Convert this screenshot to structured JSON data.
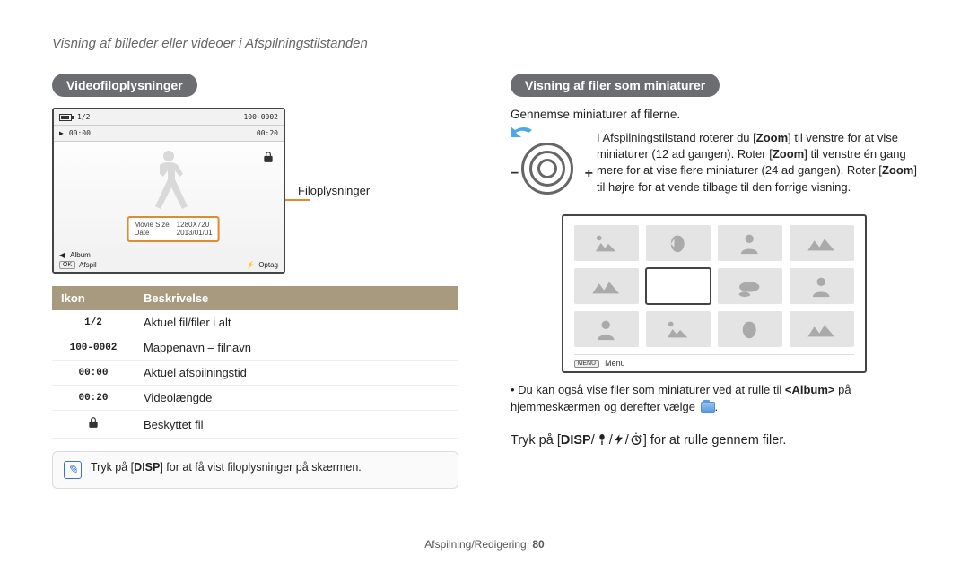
{
  "page_title": "Visning af billeder eller videoer i Afspilningstilstanden",
  "footer": {
    "section": "Afspilning/Redigering",
    "page": "80"
  },
  "left": {
    "heading": "Videofiloplysninger",
    "player": {
      "counter": "1/2",
      "time_elapsed": "00:00",
      "folder_file": "100-0002",
      "duration": "00:20",
      "info_rows": [
        {
          "k": "Movie Size",
          "v": "1280X720"
        },
        {
          "k": "Date",
          "v": "2013/01/01"
        }
      ],
      "album_label": "Album",
      "ok_label": "OK",
      "play_label": "Afspil",
      "rec_label": "Optag"
    },
    "callout_label": "Filoplysninger",
    "table": {
      "head": {
        "icon": "Ikon",
        "desc": "Beskrivelse"
      },
      "rows": [
        {
          "icon": "1/2",
          "desc": "Aktuel fil/filer i alt"
        },
        {
          "icon": "100-0002",
          "desc": "Mappenavn – filnavn"
        },
        {
          "icon": "00:00",
          "desc": "Aktuel afspilningstid"
        },
        {
          "icon": "00:20",
          "desc": "Videolængde"
        },
        {
          "icon": "lock",
          "desc": "Beskyttet fil"
        }
      ]
    },
    "note_prefix": "Tryk på [",
    "note_disp": "DISP",
    "note_suffix": "] for at få vist filoplysninger på skærmen."
  },
  "right": {
    "heading": "Visning af filer som miniaturer",
    "subtext": "Gennemse miniaturer af filerne.",
    "zoom_text_1": "I Afspilningstilstand roterer du [",
    "zoom_bold_1": "Zoom",
    "zoom_text_2": "] til venstre for at vise miniaturer (12 ad gangen). Roter [",
    "zoom_bold_2": "Zoom",
    "zoom_text_3": "] til venstre én gang mere for at vise flere miniaturer (24 ad gangen). Roter [",
    "zoom_bold_3": "Zoom",
    "zoom_text_4": "] til højre for at vende tilbage til den forrige visning.",
    "menu_chip": "MENU",
    "menu_label": "Menu",
    "bullet_1a": "Du kan også vise filer som miniaturer ved at rulle til ",
    "bullet_1_bold": "<Album>",
    "bullet_1b": " på hjemmeskærmen og derefter vælge ",
    "scroll_prefix": "Tryk på [",
    "scroll_disp": "DISP",
    "scroll_suffix": "] for at rulle gennem filer."
  }
}
